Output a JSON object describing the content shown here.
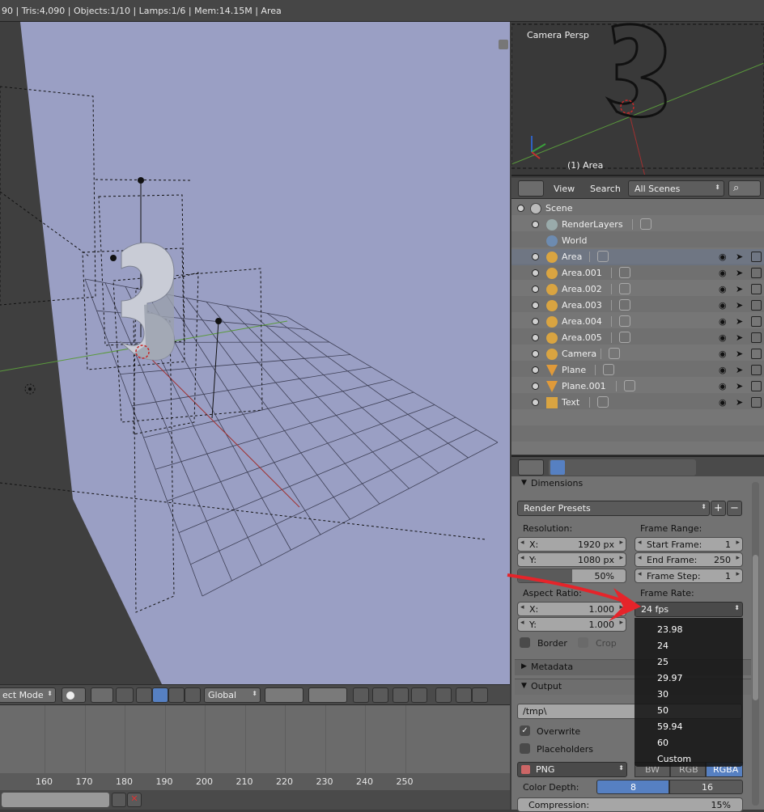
{
  "top_bar": {
    "stats": "90 | Tris:4,090 | Objects:1/10 | Lamps:1/6 | Mem:14.15M | Area"
  },
  "camera_view": {
    "label": "Camera Persp",
    "object_label": "(1) Area"
  },
  "viewport_toolbar": {
    "mode": "ect Mode",
    "orientation": "Global"
  },
  "timeline": {
    "ticks": [
      "160",
      "170",
      "180",
      "190",
      "200",
      "210",
      "220",
      "230",
      "240",
      "250"
    ]
  },
  "outliner": {
    "menu_view": "View",
    "menu_search": "Search",
    "scene_selector": "All Scenes",
    "scene": "Scene",
    "items": [
      {
        "label": "RenderLayers",
        "kind": "renderlayers"
      },
      {
        "label": "World",
        "kind": "world"
      },
      {
        "label": "Area",
        "kind": "lamp",
        "selected": true
      },
      {
        "label": "Area.001",
        "kind": "lamp"
      },
      {
        "label": "Area.002",
        "kind": "lamp"
      },
      {
        "label": "Area.003",
        "kind": "lamp"
      },
      {
        "label": "Area.004",
        "kind": "lamp"
      },
      {
        "label": "Area.005",
        "kind": "lamp"
      },
      {
        "label": "Camera",
        "kind": "camera"
      },
      {
        "label": "Plane",
        "kind": "mesh"
      },
      {
        "label": "Plane.001",
        "kind": "mesh"
      },
      {
        "label": "Text",
        "kind": "text"
      }
    ]
  },
  "properties": {
    "dimensions": {
      "header": "Dimensions",
      "render_presets": "Render Presets",
      "resolution_label": "Resolution:",
      "res_x_label": "X:",
      "res_x": "1920 px",
      "res_y_label": "Y:",
      "res_y": "1080 px",
      "res_pct": "50%",
      "frame_range_label": "Frame Range:",
      "start_label": "Start Frame:",
      "start_value": "1",
      "end_label": "End Frame:",
      "end_value": "250",
      "step_label": "Frame Step:",
      "step_value": "1",
      "aspect_label": "Aspect Ratio:",
      "asp_x_label": "X:",
      "asp_x": "1.000",
      "asp_y_label": "Y:",
      "asp_y": "1.000",
      "frame_rate_label": "Frame Rate:",
      "frame_rate_value": "24 fps",
      "border_label": "Border",
      "crop_label": "Crop"
    },
    "metadata": {
      "header": "Metadata"
    },
    "output": {
      "header": "Output",
      "path": "/tmp\\",
      "overwrite": "Overwrite",
      "placeholders": "Placeholders",
      "format": "PNG",
      "color_bw": "BW",
      "color_rgb": "RGB",
      "color_rgba": "RGBA",
      "color_depth_label": "Color Depth:",
      "depth_8": "8",
      "depth_16": "16",
      "compression_label": "Compression:",
      "compression_value": "15%"
    }
  },
  "frame_rate_dropdown": {
    "options": [
      "23.98",
      "24",
      "25",
      "29.97",
      "30",
      "50",
      "59.94",
      "60",
      "Custom"
    ]
  },
  "colors": {
    "viewport_bg": "#9a9fc4",
    "accent_blue": "#5680c2",
    "panel_bg": "#727272",
    "annotation_arrow": "#e5242a"
  }
}
